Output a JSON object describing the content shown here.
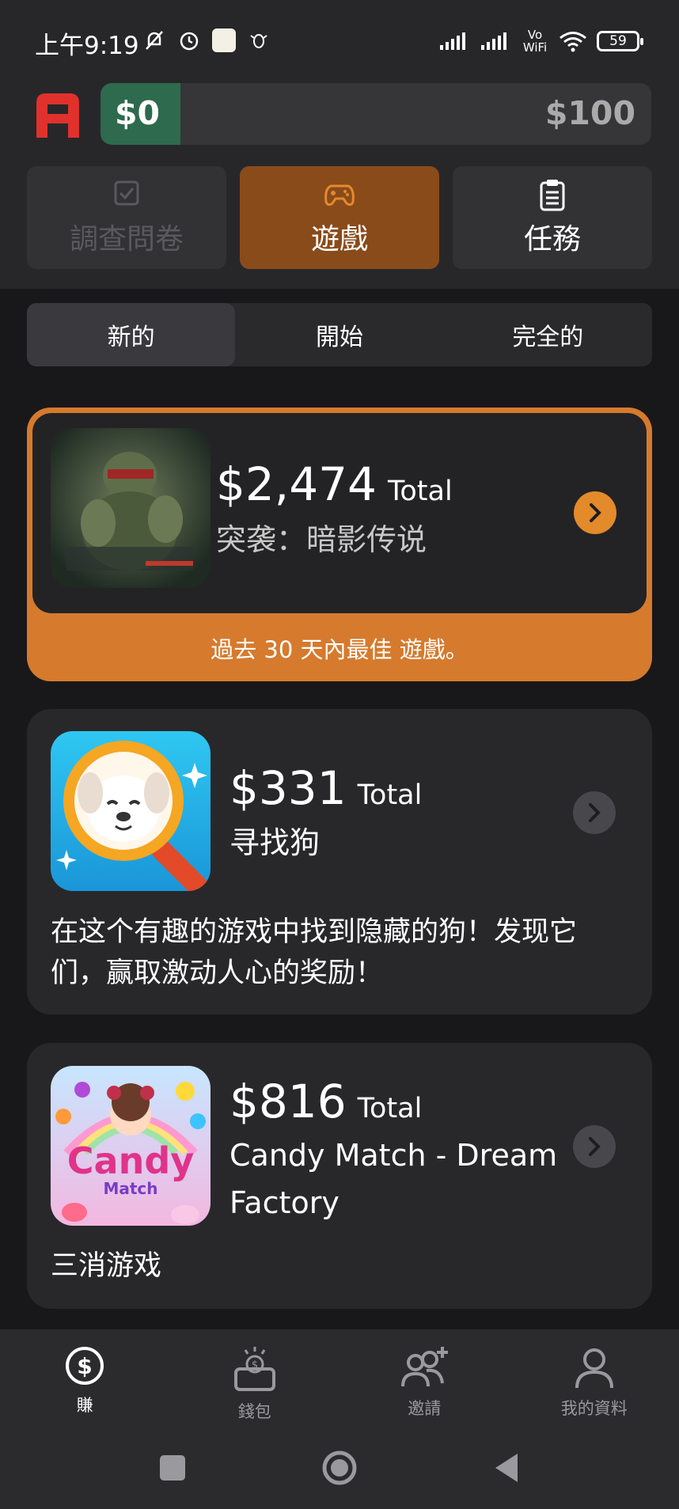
{
  "status_bar": {
    "time": "上午9:19",
    "battery": "59",
    "network": "Vo WiFi"
  },
  "balance": {
    "current": "$0",
    "goal": "$100",
    "progress_fraction": 0
  },
  "categories": [
    {
      "label": "調查問卷",
      "icon": "checkbox-icon",
      "state": "disabled"
    },
    {
      "label": "遊戲",
      "icon": "gamepad-icon",
      "state": "active"
    },
    {
      "label": "任務",
      "icon": "clipboard-icon",
      "state": "normal"
    }
  ],
  "subtabs": [
    "新的",
    "開始",
    "完全的"
  ],
  "active_subtab": "新的",
  "games": [
    {
      "amount": "$2,474",
      "total_label": "Total",
      "name": "突袭：暗影传说",
      "featured_note": "過去 30 天內最佳 遊戲。",
      "thumb": "turtle-warrior-thumbnail"
    },
    {
      "amount": "$331",
      "total_label": "Total",
      "name": "寻找狗",
      "description": "在这个有趣的游戏中找到隐藏的狗！发现它们，赢取激动人心的奖励！",
      "thumb": "dog-magnifier-thumbnail"
    },
    {
      "amount": "$816",
      "total_label": "Total",
      "name_line1": "Candy Match - Dream",
      "name_line2": "Factory",
      "description": "三消游戏",
      "thumb": "candy-match-thumbnail",
      "thumb_text1": "Candy",
      "thumb_text2": "Match"
    }
  ],
  "bottom_nav": [
    {
      "label": "賺",
      "icon": "dollar-circle-icon",
      "active": true
    },
    {
      "label": "錢包",
      "icon": "wallet-icon",
      "active": false
    },
    {
      "label": "邀請",
      "icon": "invite-users-icon",
      "active": false
    },
    {
      "label": "我的資料",
      "icon": "profile-icon",
      "active": false
    }
  ],
  "colors": {
    "accent_orange": "#d67a2d",
    "progress_green": "#2e6a4d",
    "logo_red": "#e0312c"
  }
}
